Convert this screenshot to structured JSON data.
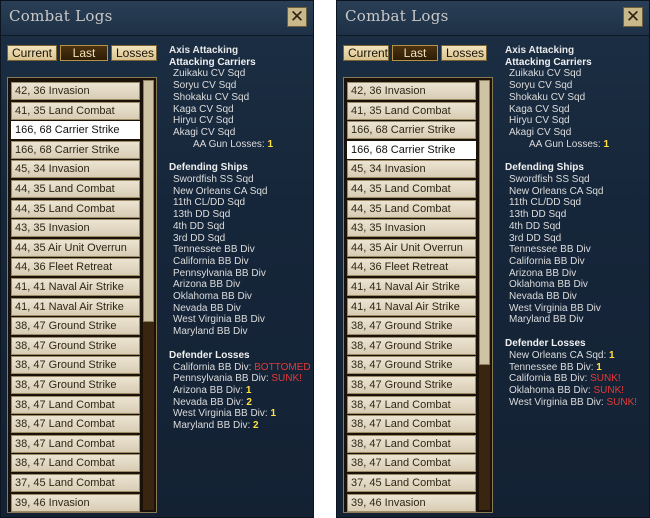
{
  "panels": [
    {
      "title": "Combat Logs",
      "tabs": [
        "Current",
        "Last",
        "Losses"
      ],
      "active_tab": 1,
      "selected_index": 2,
      "scroll_fraction": 0.56,
      "rows": [
        "42, 36 Invasion",
        "41, 35 Land Combat",
        "166, 68 Carrier Strike",
        "166, 68 Carrier Strike",
        "45, 34 Invasion",
        "44, 35 Land Combat",
        "44, 35 Land Combat",
        "43, 35 Invasion",
        "44, 35 Air Unit Overrun",
        "44, 36 Fleet Retreat",
        "41, 41 Naval Air Strike",
        "41, 41 Naval Air Strike",
        "38, 47 Ground Strike",
        "38, 47 Ground Strike",
        "38, 47 Ground Strike",
        "38, 47 Ground Strike",
        "38, 47 Land Combat",
        "38, 47 Land Combat",
        "38, 47 Land Combat",
        "38, 47 Land Combat",
        "37, 45 Land Combat",
        "39, 46 Invasion"
      ],
      "attacker": "Axis Attacking",
      "attacking_header": "Attacking Carriers",
      "attacking": [
        "Zuikaku CV Sqd",
        "Soryu CV Sqd",
        "Shokaku CV Sqd",
        "Kaga CV Sqd",
        "Hiryu CV Sqd",
        "Akagi CV Sqd"
      ],
      "aa_label": "AA Gun Losses:",
      "aa_value": "1",
      "defending_header": "Defending Ships",
      "defending": [
        "Swordfish SS Sqd",
        "New Orleans CA Sqd",
        "11th CL/DD Sqd",
        "13th DD Sqd",
        "4th DD Sqd",
        "3rd DD Sqd",
        "Tennessee BB Div",
        "California BB Div",
        "Pennsylvania BB Div",
        "Arizona BB Div",
        "Oklahoma BB Div",
        "Nevada BB Div",
        "West Virginia BB Div",
        "Maryland BB Div"
      ],
      "losses_header": "Defender Losses",
      "losses": [
        {
          "name": "California BB Div:",
          "value": "BOTTOMED",
          "color": "red"
        },
        {
          "name": "Pennsylvania BB Div:",
          "value": "SUNK!",
          "color": "red"
        },
        {
          "name": "Arizona BB Div:",
          "value": "1",
          "color": "yellow"
        },
        {
          "name": "Nevada BB Div:",
          "value": "2",
          "color": "yellow"
        },
        {
          "name": "West Virginia BB Div:",
          "value": "1",
          "color": "yellow"
        },
        {
          "name": "Maryland BB Div:",
          "value": "2",
          "color": "yellow"
        }
      ]
    },
    {
      "title": "Combat Logs",
      "tabs": [
        "Current",
        "Last",
        "Losses"
      ],
      "active_tab": 1,
      "selected_index": 3,
      "scroll_fraction": 0.66,
      "rows": [
        "42, 36 Invasion",
        "41, 35 Land Combat",
        "166, 68 Carrier Strike",
        "166, 68 Carrier Strike",
        "45, 34 Invasion",
        "44, 35 Land Combat",
        "44, 35 Land Combat",
        "43, 35 Invasion",
        "44, 35 Air Unit Overrun",
        "44, 36 Fleet Retreat",
        "41, 41 Naval Air Strike",
        "41, 41 Naval Air Strike",
        "38, 47 Ground Strike",
        "38, 47 Ground Strike",
        "38, 47 Ground Strike",
        "38, 47 Ground Strike",
        "38, 47 Land Combat",
        "38, 47 Land Combat",
        "38, 47 Land Combat",
        "38, 47 Land Combat",
        "37, 45 Land Combat",
        "39, 46 Invasion"
      ],
      "attacker": "Axis Attacking",
      "attacking_header": "Attacking Carriers",
      "attacking": [
        "Zuikaku CV Sqd",
        "Soryu CV Sqd",
        "Shokaku CV Sqd",
        "Kaga CV Sqd",
        "Hiryu CV Sqd",
        "Akagi CV Sqd"
      ],
      "aa_label": "AA Gun Losses:",
      "aa_value": "1",
      "defending_header": "Defending Ships",
      "defending": [
        "Swordfish SS Sqd",
        "New Orleans CA Sqd",
        "11th CL/DD Sqd",
        "13th DD Sqd",
        "4th DD Sqd",
        "3rd DD Sqd",
        "Tennessee BB Div",
        "California BB Div",
        "Arizona BB Div",
        "Oklahoma BB Div",
        "Nevada BB Div",
        "West Virginia BB Div",
        "Maryland BB Div"
      ],
      "losses_header": "Defender Losses",
      "losses": [
        {
          "name": "New Orleans CA Sqd:",
          "value": "1",
          "color": "yellow"
        },
        {
          "name": "Tennessee BB Div:",
          "value": "1",
          "color": "yellow"
        },
        {
          "name": "California BB Div:",
          "value": "SUNK!",
          "color": "red"
        },
        {
          "name": "Oklahoma BB Div:",
          "value": "SUNK!",
          "color": "red"
        },
        {
          "name": "West Virginia BB Div:",
          "value": "SUNK!",
          "color": "red"
        }
      ]
    }
  ],
  "icons": {
    "close": "close-icon"
  },
  "colors": {
    "loss_red": "#e23a3a",
    "loss_yellow": "#ffe040"
  }
}
